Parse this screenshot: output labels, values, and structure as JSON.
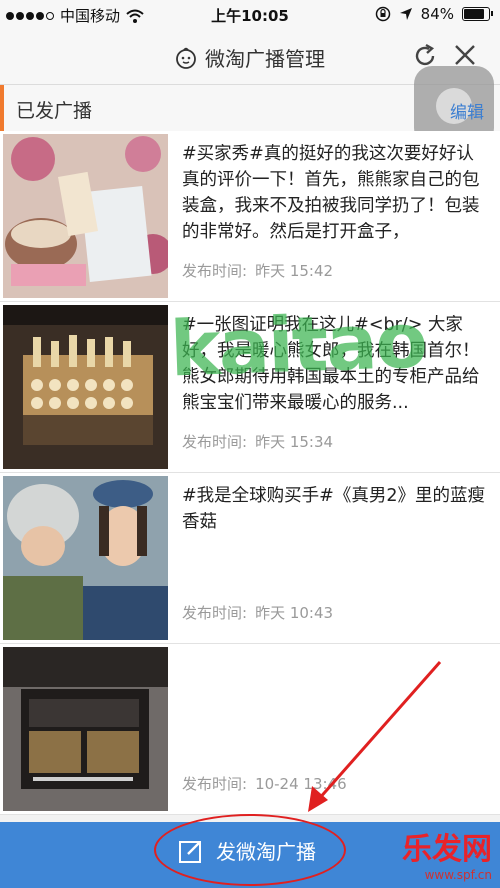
{
  "status_bar": {
    "carrier": "中国移动",
    "time": "上午10:05",
    "battery": "84%"
  },
  "header": {
    "title": "微淘广播管理"
  },
  "section": {
    "title": "已发广播",
    "edit_label": "编辑"
  },
  "posts": [
    {
      "text": "#买家秀#真的挺好的我这次要好好认真的评价一下！首先，熊熊家自己的包装盒，我来不及拍被我同学扔了！包装的非常好。然后是打开盒子，",
      "time_label": "发布时间:",
      "time": "昨天 15:42"
    },
    {
      "text": "#一张图证明我在这儿#<br/> 大家好，我是暖心熊女郎，我在韩国首尔！熊女郎期待用韩国最本土的专柜产品给熊宝宝们带来最暖心的服务...",
      "time_label": "发布时间:",
      "time": "昨天 15:34"
    },
    {
      "text": "#我是全球购买手#《真男2》里的蓝瘦香菇",
      "time_label": "发布时间:",
      "time": "昨天 10:43"
    },
    {
      "text": "",
      "time_label": "发布时间:",
      "time": "10-24 13:46"
    }
  ],
  "bottom": {
    "publish_label": "发微淘广播"
  },
  "watermark": {
    "text": "kaitao",
    "logo": "乐发网",
    "url": "www.spf.cn"
  },
  "colors": {
    "accent_orange": "#f07a2e",
    "bottom_bar": "#3f86d6",
    "callout_red": "#e02020"
  }
}
